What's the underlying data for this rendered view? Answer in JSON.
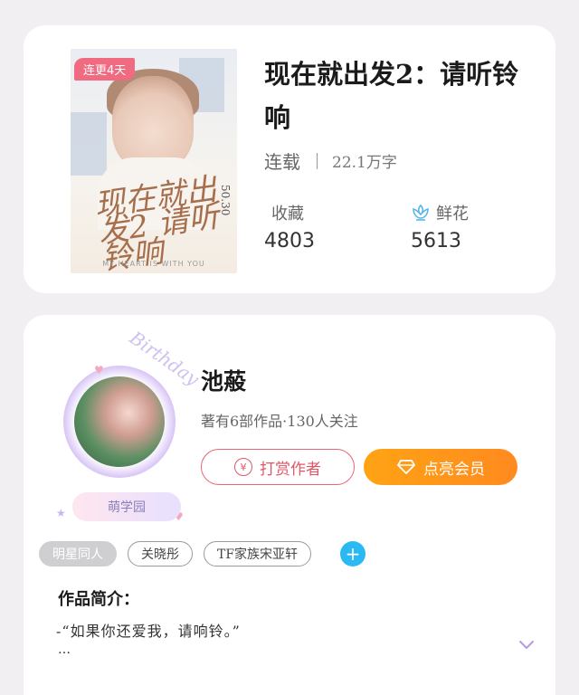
{
  "book": {
    "badge": "连更4天",
    "cover_art_text": "现在就出发2 请听铃响",
    "cover_side_text": "50.30",
    "cover_footer": "MY HEART IS WITH YOU",
    "title": "现在就出发2：请听铃响",
    "status": "连载",
    "word_count": "22.1万字",
    "favorites_label": "收藏",
    "favorites_count": "4803",
    "flowers_label": "鲜花",
    "flowers_count": "5613",
    "flower_icon_color": "#5bb6e6"
  },
  "author": {
    "avatar_decoration_text": "Birthday",
    "avatar_tag": "萌学园",
    "name": "池蒰",
    "meta": "著有6部作品·130人关注",
    "tip_button": "打赏作者",
    "tip_icon": "¥",
    "vip_button": "点亮会员",
    "vip_icon": "diamond-icon"
  },
  "tags": {
    "items": [
      "明星同人",
      "关晓彤",
      "TF家族宋亚轩"
    ],
    "add_icon": "+"
  },
  "intro": {
    "title": "作品简介：",
    "text": "-“如果你还爱我，请响铃。”",
    "more": "…",
    "expand_icon": "chevron-down-icon"
  },
  "colors": {
    "accent_red": "#e05766",
    "accent_orange": "#ff9a18",
    "accent_blue": "#2ab9f2",
    "badge_pink": "#f06b82"
  }
}
